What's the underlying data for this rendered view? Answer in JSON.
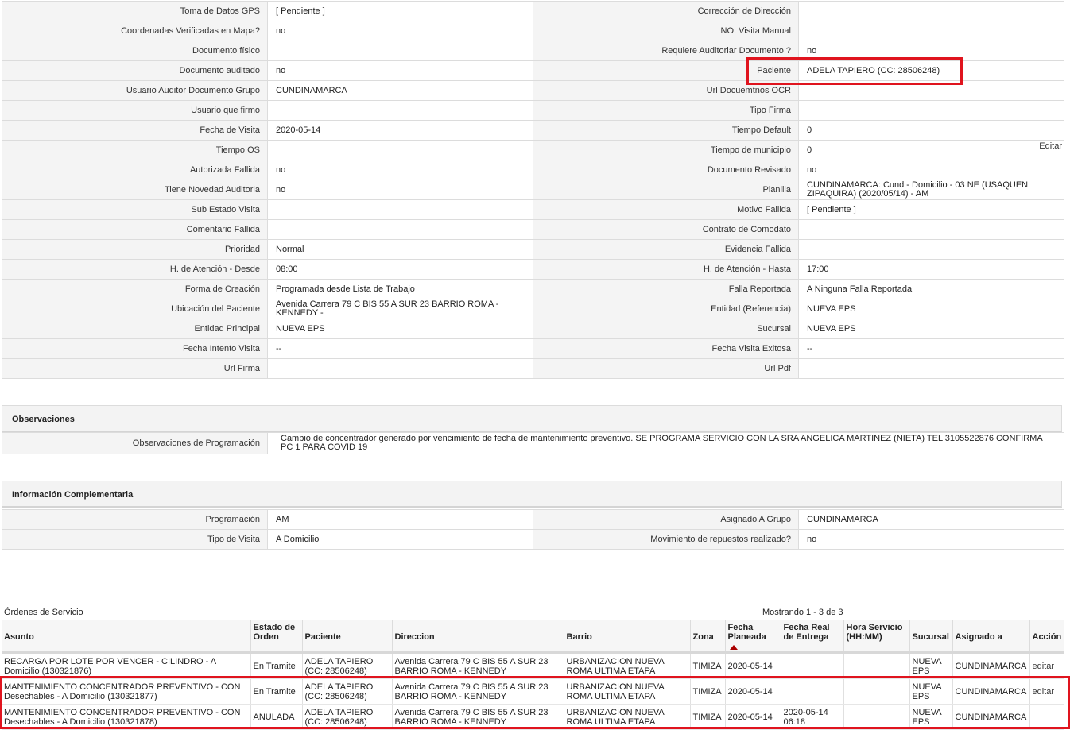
{
  "main_rows": [
    [
      "Toma de Datos GPS",
      "[ Pendiente ]",
      "Corrección de Dirección",
      ""
    ],
    [
      "Coordenadas Verificadas en Mapa?",
      "no",
      "NO. Visita Manual",
      ""
    ],
    [
      "Documento físico",
      "",
      "Requiere Auditoriar Documento ?",
      "no"
    ],
    [
      "Documento auditado",
      "no",
      "Paciente",
      "ADELA TAPIERO (CC: 28506248)"
    ],
    [
      "Usuario Auditor Documento Grupo",
      "CUNDINAMARCA",
      "Url Docuemtnos OCR",
      ""
    ],
    [
      "Usuario que firmo",
      "",
      "Tipo Firma",
      ""
    ],
    [
      "Fecha de Visita",
      "2020-05-14",
      "Tiempo Default",
      "0"
    ],
    [
      "Tiempo OS",
      "",
      "Tiempo de municipio",
      "0"
    ],
    [
      "Autorizada Fallida",
      "no",
      "Documento Revisado",
      "no"
    ],
    [
      "Tiene Novedad Auditoria",
      "no",
      "Planilla",
      "CUNDINAMARCA: Cund - Domicilio - 03 NE (USAQUEN ZIPAQUIRA) (2020/05/14) - AM"
    ],
    [
      "Sub Estado Visita",
      "",
      "Motivo Fallida",
      "[ Pendiente ]"
    ],
    [
      "Comentario Fallida",
      "",
      "Contrato de Comodato",
      ""
    ],
    [
      "Prioridad",
      "Normal",
      "Evidencia Fallida",
      ""
    ],
    [
      "H. de Atención - Desde",
      "08:00",
      "H. de Atención - Hasta",
      "17:00"
    ],
    [
      "Forma de Creación",
      "Programada desde Lista de Trabajo",
      "Falla Reportada",
      "A Ninguna Falla Reportada"
    ],
    [
      "Ubicación del Paciente",
      "Avenida Carrera 79 C BIS 55 A SUR 23 BARRIO ROMA - KENNEDY -",
      "Entidad (Referencia)",
      "NUEVA EPS"
    ],
    [
      "Entidad Principal",
      "NUEVA EPS",
      "Sucursal",
      "NUEVA EPS"
    ],
    [
      "Fecha Intento Visita",
      "--",
      "Fecha Visita Exitosa",
      "--"
    ],
    [
      "Url Firma",
      "",
      "Url Pdf",
      ""
    ]
  ],
  "editar_label": "Editar",
  "observaciones": {
    "title": "Observaciones",
    "label": "Observaciones de Programación",
    "value": "Cambio de concentrador generado por vencimiento de fecha de mantenimiento preventivo. SE PROGRAMA SERVICIO CON LA SRA ANGELICA MARTINEZ (NIETA) TEL 3105522876 CONFIRMA PC 1 PARA COVID 19"
  },
  "complementaria": {
    "title": "Información Complementaria",
    "rows": [
      [
        "Programación",
        "AM",
        "Asignado A Grupo",
        "CUNDINAMARCA"
      ],
      [
        "Tipo de Visita",
        "A Domicilio",
        "Movimiento de repuestos realizado?",
        "no"
      ]
    ]
  },
  "orders": {
    "title": "Órdenes de Servicio",
    "count": "Mostrando 1 - 3 de 3",
    "columns": [
      "Asunto",
      "Estado de Orden",
      "Paciente",
      "Direccion",
      "Barrio",
      "Zona",
      "Fecha Planeada",
      "Fecha Real de Entrega",
      "Hora Servicio (HH:MM)",
      "Sucursal",
      "Asignado a",
      "Acción"
    ],
    "rows": [
      [
        "RECARGA POR LOTE POR VENCER - CILINDRO - A Domicilio (130321876)",
        "En Tramite",
        "ADELA TAPIERO (CC: 28506248)",
        "Avenida Carrera 79 C BIS 55 A SUR 23 BARRIO ROMA - KENNEDY",
        "URBANIZACION NUEVA ROMA ULTIMA ETAPA",
        "TIMIZA",
        "2020-05-14",
        "",
        "",
        "NUEVA EPS",
        "CUNDINAMARCA",
        "editar"
      ],
      [
        "MANTENIMIENTO CONCENTRADOR PREVENTIVO - CON Desechables - A Domicilio (130321877)",
        "En Tramite",
        "ADELA TAPIERO (CC: 28506248)",
        "Avenida Carrera 79 C BIS 55 A SUR 23 BARRIO ROMA - KENNEDY",
        "URBANIZACION NUEVA ROMA ULTIMA ETAPA",
        "TIMIZA",
        "2020-05-14",
        "",
        "",
        "NUEVA EPS",
        "CUNDINAMARCA",
        "editar"
      ],
      [
        "MANTENIMIENTO CONCENTRADOR PREVENTIVO - CON Desechables - A Domicilio (130321878)",
        "ANULADA",
        "ADELA TAPIERO (CC: 28506248)",
        "Avenida Carrera 79 C BIS 55 A SUR 23 BARRIO ROMA - KENNEDY",
        "URBANIZACION NUEVA ROMA ULTIMA ETAPA",
        "TIMIZA",
        "2020-05-14",
        "2020-05-14 06:18",
        "",
        "NUEVA EPS",
        "CUNDINAMARCA",
        ""
      ]
    ]
  },
  "colors": {
    "highlight": "#e0141e",
    "label_bg": "#f4f4f4",
    "border": "#dcdcdc"
  }
}
